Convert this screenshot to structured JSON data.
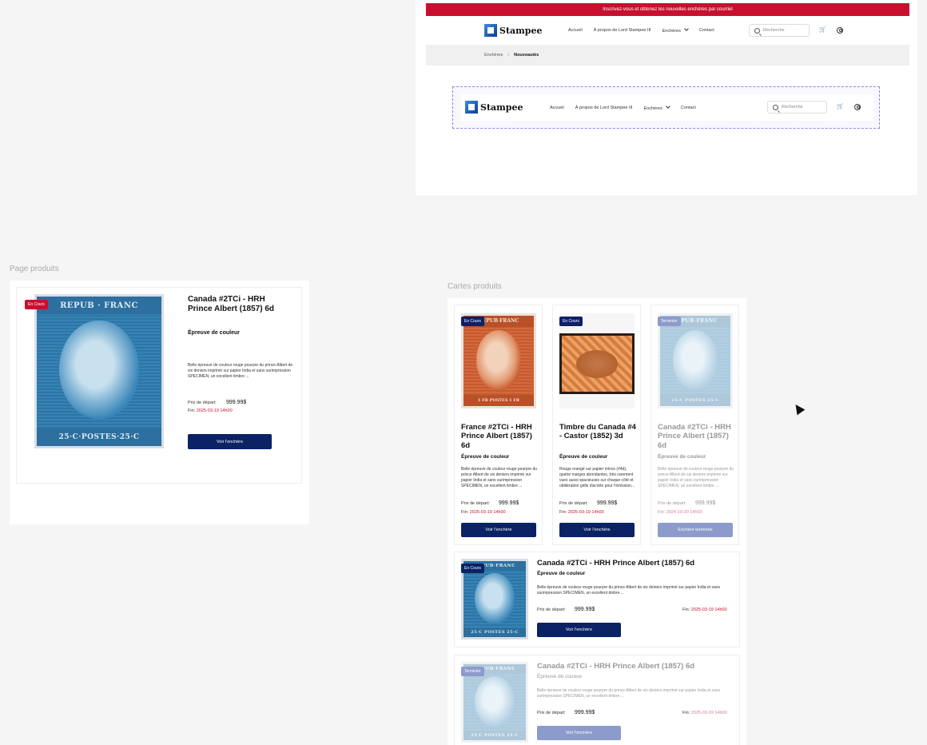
{
  "header": {
    "promo": "Inscrivez-vous et obtenez les nouvelles enchères par courriel",
    "logo": "Stampee",
    "nav": [
      "Accueil",
      "À propos de Lord Stampee III",
      "Enchères",
      "Contact"
    ],
    "search_placeholder": "Recherche",
    "breadcrumb": [
      "Enchères",
      "Nouveautés"
    ]
  },
  "sections": {
    "page_label": "Page produits",
    "cards_label": "Cartes produits"
  },
  "product_page": {
    "badge": "En Cours",
    "title": "Canada #2TCi - HRH Prince Albert  (1857) 6d",
    "subtitle": "Épreuve de couleur",
    "description": "Belle épreuve de couleur rouge pourpre du prince Albert de six deniers imprimé sur papier India et sans surimpression SPECIMEN, un excellent timbre ...",
    "price_label": "Prix de départ:",
    "price": "999.99$",
    "end_label": "Fin:",
    "end_date": "2025-03-19 14h00",
    "button": "Voir l'enchère",
    "stamp_top": "REPUB · FRANC",
    "stamp_bottom": "25·C·POSTES·25·C"
  },
  "cards": [
    {
      "badge": "En Cours",
      "title": "France #2TCi - HRH Prince Albert (1857) 6d",
      "subtitle": "Épreuve de couleur",
      "description": "Belle épreuve de couleur rouge pourpre du prince Albert de six deniers imprimé sur papier India et sans surimpression SPECIMEN, un excellent timbre ...",
      "price_label": "Prix de départ:",
      "price": "999.99$",
      "end_label": "Fin:",
      "end_date": "2025-03-19 14h00",
      "button": "Voir l'enchère",
      "stamp_top": "REPUB·FRANC",
      "stamp_bottom": "1 FR POSTES 1 FR"
    },
    {
      "badge": "En Cours",
      "title": "Timbre du Canada #4 - Castor (1852) 3d",
      "subtitle": "Épreuve de couleur",
      "description": "Rouge orangé sur papier mince (#4d), quatre marges abondantes, très rarement vues aussi spacieuses sur chaque côté et oblitération grille discrète pour l'émission...",
      "price_label": "Prix de départ:",
      "price": "999.99$",
      "end_label": "Fin:",
      "end_date": "2025-03-19 14h00",
      "button": "Voir l'enchère"
    },
    {
      "badge": "Terminée",
      "title": "Canada #2TCi - HRH Prince Albert (1857) 6d",
      "subtitle": "Épreuve de couleur",
      "description": "Belle épreuve de couleur rouge pourpre du prince Albert de six deniers imprimé sur papier India et sans surimpression SPECIMEN, un excellent timbre ...",
      "price_label": "Prix de départ:",
      "price": "999.99$",
      "end_label": "Fin:",
      "end_date": "2024-10-20 14h00",
      "button": "Enchère terminée",
      "stamp_top": "REPUB·FRANC",
      "stamp_bottom": "25·C POSTES 25·C"
    }
  ],
  "hcards": [
    {
      "badge": "En Cours",
      "title": "Canada #2TCi - HRH Prince Albert  (1857) 6d",
      "subtitle": "Épreuve de couleur",
      "description": "Belle épreuve de couleur rouge pourpre du prince Albert de six deniers imprimé sur papier India et sans surimpression SPECIMEN, un excellent timbre ...",
      "price_label": "Prix de départ:",
      "price": "999.99$",
      "end_label": "Fin:",
      "end_date": "2025-03-19 14h00",
      "button": "Voir l'enchère",
      "stamp_top": "REPUB·FRANC",
      "stamp_bottom": "25·C POSTES 25·C"
    },
    {
      "badge": "Terminée",
      "title": "Canada #2TCi - HRH Prince Albert  (1857) 6d",
      "subtitle": "Épreuve de couleur",
      "description": "Belle épreuve de couleur rouge pourpre du prince Albert de six deniers imprimé sur papier India et sans surimpression SPECIMEN, un excellent timbre ...",
      "price_label": "Prix de départ:",
      "price": "999.99$",
      "end_label": "Fin:",
      "end_date": "2025-03-19 14h00",
      "button": "Voir l'enchère",
      "stamp_top": "REPUB·FRANC",
      "stamp_bottom": "25·C POSTES 25·C"
    }
  ],
  "colors": {
    "brand_red": "#c8102e",
    "brand_navy": "#0b2265",
    "faded_navy": "#8d9bcc",
    "accent_purple": "#9b7fe0"
  }
}
